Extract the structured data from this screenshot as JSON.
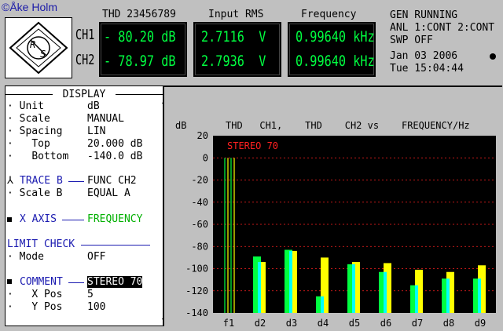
{
  "credit": "©Åke Holm",
  "header": {
    "thd": "THD 23456789",
    "rms": "Input RMS",
    "freq": "Frequency",
    "ch1_label": "CH1",
    "ch2_label": "CH2",
    "ch1_thd": "- 80.20 dB",
    "ch2_thd": "- 78.97 dB",
    "ch1_rms": "2.7116  V",
    "ch2_rms": "2.7936  V",
    "ch1_freq": "0.99640 kHz",
    "ch2_freq": "0.99640 kHz",
    "gen_line1": "GEN RUNNING",
    "gen_line2": "ANL 1:CONT 2:CONT",
    "gen_line3": "SWP OFF",
    "date": "Jan 03 2006",
    "time": "Tue 15:04:44"
  },
  "panel": {
    "title": "DISPLAY",
    "rows": [
      {
        "key": "Unit",
        "val": "dB"
      },
      {
        "key": "Scale",
        "val": "MANUAL"
      },
      {
        "key": "Spacing",
        "val": "LIN"
      },
      {
        "key": "Top",
        "val": "20.000 dB"
      },
      {
        "key": "Bottom",
        "val": "-140.0 dB"
      }
    ],
    "trace_b": "TRACE B",
    "trace_b_val": "FUNC CH2",
    "scale_b": "Scale B",
    "scale_b_val": "EQUAL A",
    "x_axis": "X AXIS",
    "x_axis_val": "FREQUENCY",
    "limit_check": "LIMIT CHECK",
    "mode": "Mode",
    "mode_val": "OFF",
    "comment": "COMMENT",
    "comment_val": "STEREO 70",
    "xpos": "X Pos",
    "xpos_val": "5",
    "ypos": "Y Pos",
    "ypos_val": "100"
  },
  "chart_data": {
    "type": "bar",
    "title": "THD   CH1,    THD    CH2 vs    FREQUENCY/Hz",
    "ylabel": "dB",
    "annotation": "STEREO 70",
    "ylim": [
      -140,
      20
    ],
    "yticks": [
      "20",
      "0",
      "-20",
      "-40",
      "-60",
      "-80",
      "-100",
      "-120",
      "-140"
    ],
    "categories": [
      "f1",
      "d2",
      "d3",
      "d4",
      "d5",
      "d6",
      "d7",
      "d8",
      "d9"
    ],
    "series": [
      {
        "values": [
          0,
          -89,
          -83,
          -125,
          -96,
          -103,
          -115,
          -109,
          -109
        ]
      },
      {
        "values": [
          0,
          -94,
          -84,
          -90,
          -94,
          -95,
          -101,
          -103,
          -97
        ]
      }
    ],
    "colors": {
      "ch1": "#00ff40",
      "ch2": "#ffff00",
      "overlap": "#00ffff",
      "trace": "#ff2020"
    }
  }
}
